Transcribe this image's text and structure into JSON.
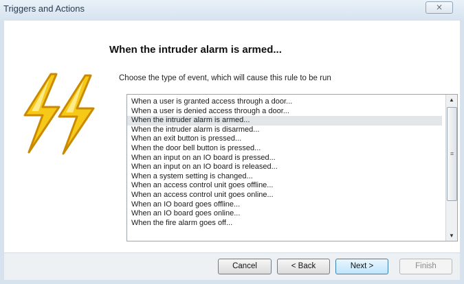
{
  "window": {
    "title": "Triggers and Actions",
    "close_glyph": "⨯"
  },
  "main": {
    "heading": "When the intruder alarm is armed...",
    "subheading": "Choose the type of event, which will cause this rule to be run"
  },
  "event_list": {
    "selected_index": 2,
    "items": [
      "When a user is granted access through a door...",
      "When a user is denied access through a door...",
      "When the intruder alarm is armed...",
      "When the intruder alarm is disarmed...",
      "When an exit button is pressed...",
      "When the door bell button is pressed...",
      "When an input on an IO board is pressed...",
      "When an input on an IO board is released...",
      "When a system setting is changed...",
      "When an access control unit goes offline...",
      "When an access control unit goes online...",
      "When an IO board goes offline...",
      "When an IO board goes online...",
      "When the fire alarm goes off..."
    ],
    "scroll": {
      "up_glyph": "▲",
      "down_glyph": "▼",
      "thumb_grip": "≡"
    }
  },
  "footer": {
    "cancel_label": "Cancel",
    "back_label": "< Back",
    "next_label": "Next >",
    "finish_label": "Finish"
  },
  "icons": {
    "logo": "lightning-bolts-icon"
  },
  "colors": {
    "bolt_fill": "#f6c817",
    "bolt_stroke": "#c98a00",
    "selection": "#e3e6e9",
    "next_accent": "#3c7fb1"
  }
}
